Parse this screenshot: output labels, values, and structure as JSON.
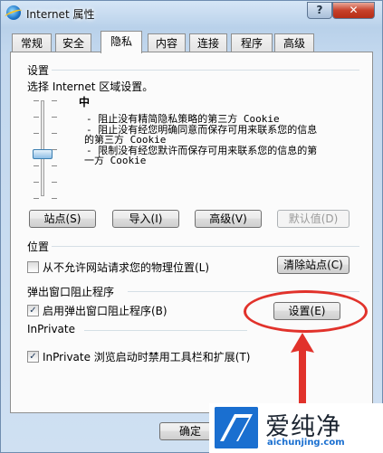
{
  "window": {
    "title": "Internet 属性",
    "help_label": "?",
    "close_label": "✕"
  },
  "tabs": [
    "常规",
    "安全",
    "隐私",
    "内容",
    "连接",
    "程序",
    "高级"
  ],
  "active_tab": "隐私",
  "settings": {
    "heading": "设置",
    "instruction": "选择 Internet 区域设置。",
    "level_name": "中",
    "slider_level": "中",
    "description": [
      "- 阻止没有精简隐私策略的第三方 Cookie",
      "- 阻止没有经您明确同意而保存可用来联系您的信息",
      "的第三方 Cookie",
      "- 限制没有经您默许而保存可用来联系您的信息的第",
      "一方 Cookie"
    ],
    "buttons": {
      "sites": "站点(S)",
      "import": "导入(I)",
      "advanced": "高级(V)",
      "default": "默认值(D)"
    }
  },
  "location": {
    "heading": "位置",
    "checkbox_label": "从不允许网站请求您的物理位置(L)",
    "checkbox_checked": false,
    "clear_sites_label": "清除站点(C)"
  },
  "popup_blocker": {
    "heading": "弹出窗口阻止程序",
    "checkbox_label": "启用弹出窗口阻止程序(B)",
    "checkbox_checked": true,
    "settings_label": "设置(E)"
  },
  "inprivate": {
    "heading": "InPrivate",
    "checkbox_label": "InPrivate 浏览启动时禁用工具栏和扩展(T)",
    "checkbox_checked": true
  },
  "footer": {
    "ok_label": "确定"
  },
  "watermark": {
    "chinese": "爱纯净",
    "url": "aichunjing.com"
  },
  "colors": {
    "annotation": "#e1322b",
    "watermark_blue": "#1a6fd0"
  }
}
